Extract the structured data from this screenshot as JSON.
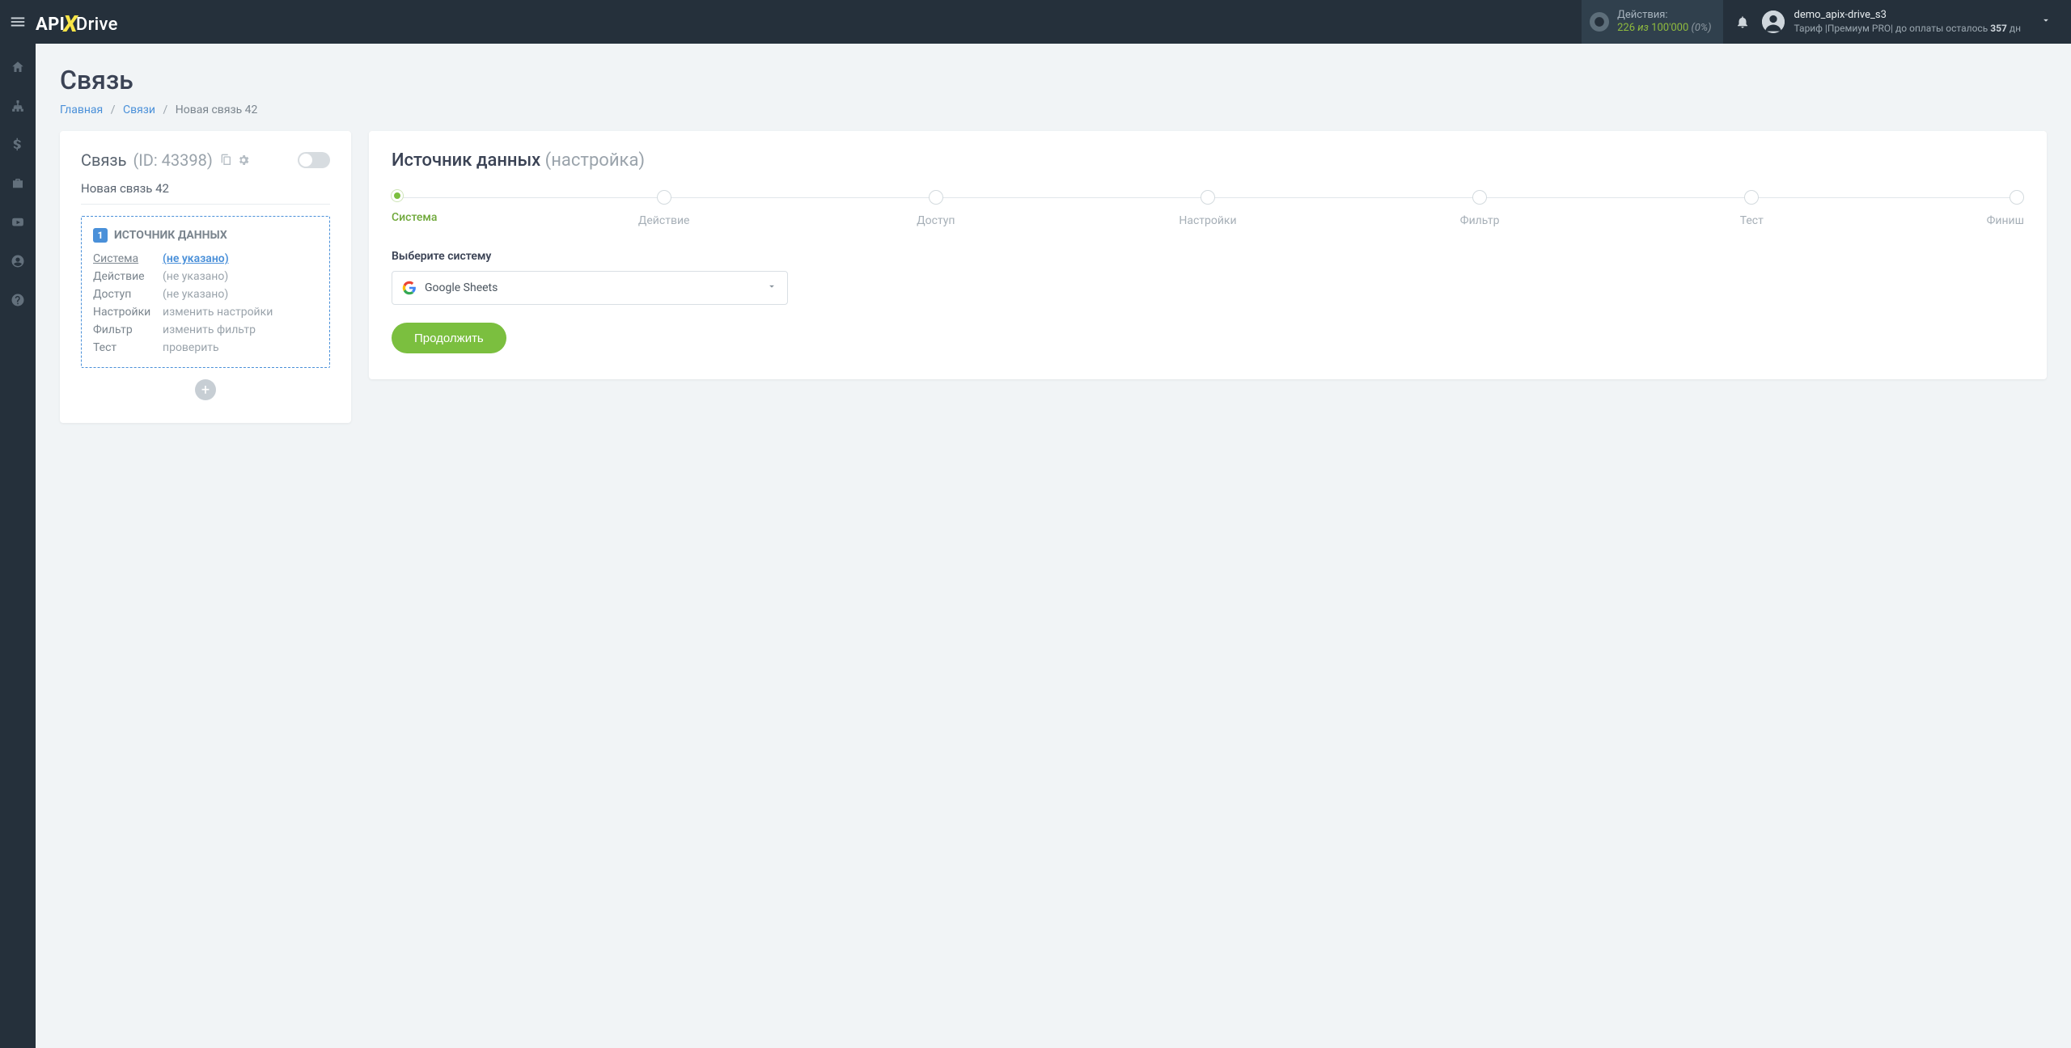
{
  "header": {
    "actions_label": "Действия:",
    "actions_count": "226",
    "actions_of": "из",
    "actions_total": "100'000",
    "actions_pct": "(0%)",
    "user_name": "demo_apix-drive_s3",
    "plan_prefix": "Тариф |",
    "plan_name": "Премиум PRO",
    "plan_sep": "|",
    "plan_rest1": " до оплаты осталось ",
    "plan_days": "357",
    "plan_rest2": " дн"
  },
  "page": {
    "title": "Связь",
    "crumb_home": "Главная",
    "crumb_links": "Связи",
    "crumb_current": "Новая связь 42"
  },
  "left": {
    "title": "Связь",
    "id_label": "(ID: 43398)",
    "conn_name": "Новая связь 42",
    "src_badge": "1",
    "src_caption": "ИСТОЧНИК ДАННЫХ",
    "rows": [
      {
        "k": "Система",
        "v": "(не указано)",
        "activeK": true,
        "link": true
      },
      {
        "k": "Действие",
        "v": "(не указано)"
      },
      {
        "k": "Доступ",
        "v": "(не указано)"
      },
      {
        "k": "Настройки",
        "v": "изменить настройки"
      },
      {
        "k": "Фильтр",
        "v": "изменить фильтр"
      },
      {
        "k": "Тест",
        "v": "проверить"
      }
    ]
  },
  "right": {
    "title_main": "Источник данных",
    "title_muted": "(настройка)",
    "steps": [
      "Система",
      "Действие",
      "Доступ",
      "Настройки",
      "Фильтр",
      "Тест",
      "Финиш"
    ],
    "active_step": 0,
    "field_label": "Выберите систему",
    "select_value": "Google Sheets",
    "continue": "Продолжить"
  }
}
